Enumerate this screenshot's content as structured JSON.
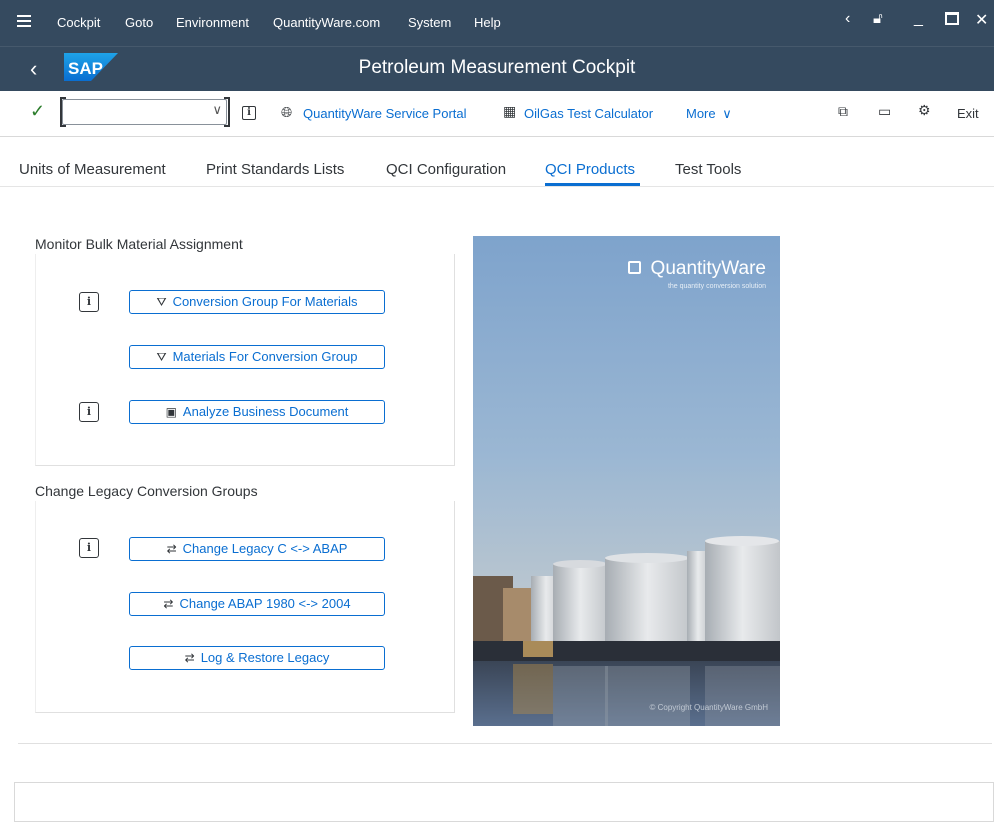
{
  "menubar": {
    "items": [
      "Cockpit",
      "Goto",
      "Environment",
      "QuantityWare.com",
      "System",
      "Help"
    ]
  },
  "titlebar": {
    "title": "Petroleum Measurement Cockpit",
    "logo": "SAP"
  },
  "toolbar": {
    "command_value": "",
    "service_portal": "QuantityWare Service Portal",
    "calculator": "OilGas Test Calculator",
    "more": "More",
    "exit": "Exit"
  },
  "tabs": [
    "Units of Measurement",
    "Print Standards Lists",
    "QCI Configuration",
    "QCI Products",
    "Test Tools"
  ],
  "active_tab": "QCI Products",
  "sections": {
    "monitor": {
      "title": "Monitor Bulk Material Assignment",
      "buttons": [
        "Conversion Group For Materials",
        "Materials For Conversion Group",
        "Analyze Business Document"
      ]
    },
    "legacy": {
      "title": "Change Legacy Conversion Groups",
      "buttons": [
        "Change Legacy C <-> ABAP",
        "Change ABAP 1980 <-> 2004",
        "Log & Restore Legacy"
      ]
    }
  },
  "image": {
    "brand": "QuantityWare",
    "tagline": "the quantity conversion solution",
    "copyright": "© Copyright QuantityWare GmbH"
  },
  "colors": {
    "shell": "#354a5f",
    "accent": "#0a6ed1",
    "check": "#2b7d2b"
  }
}
